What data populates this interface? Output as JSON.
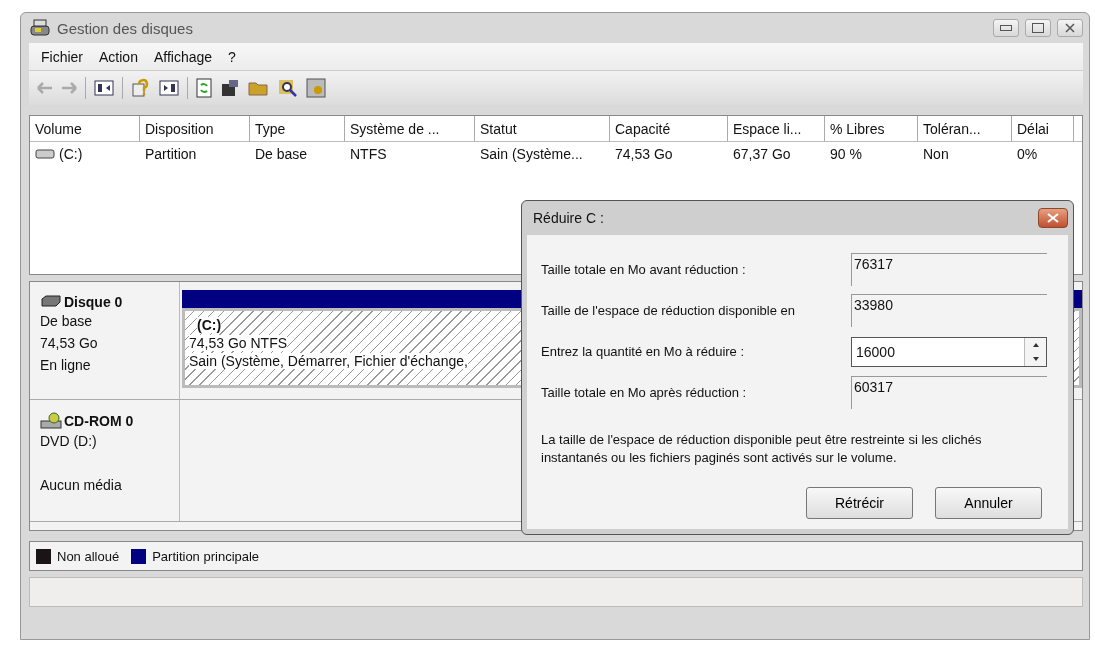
{
  "window": {
    "title": "Gestion des disques"
  },
  "menu": [
    "Fichier",
    "Action",
    "Affichage",
    "?"
  ],
  "volume_table": {
    "columns": [
      "Volume",
      "Disposition",
      "Type",
      "Système de ...",
      "Statut",
      "Capacité",
      "Espace li...",
      "% Libres",
      "Toléran...",
      "Délai"
    ],
    "rows": [
      {
        "cells": [
          "(C:)",
          "Partition",
          "De base",
          "NTFS",
          "Sain (Système...",
          "74,53 Go",
          "67,37 Go",
          "90 %",
          "Non",
          "0%"
        ]
      }
    ]
  },
  "disks": [
    {
      "kind": "disk",
      "name": "Disque 0",
      "info": [
        "De base",
        "74,53 Go",
        "En ligne"
      ],
      "partitions": [
        {
          "label": "(C:)",
          "size": "74,53 Go NTFS",
          "status": "Sain (Système, Démarrer, Fichier d'échange,"
        }
      ]
    },
    {
      "kind": "cdrom",
      "name": "CD-ROM 0",
      "info": [
        "DVD (D:)",
        "Aucun média"
      ]
    }
  ],
  "legend": [
    {
      "label": "Non alloué",
      "color": "#1a1416"
    },
    {
      "label": "Partition principale",
      "color": "#000080"
    }
  ],
  "dialog": {
    "title": "Réduire C :",
    "fields": [
      {
        "kind": "readonly",
        "label": "Taille totale en Mo avant réduction :",
        "value": "76317"
      },
      {
        "kind": "readonly",
        "label": "Taille de l'espace de réduction disponible en",
        "value": "33980"
      },
      {
        "kind": "spin",
        "label": "Entrez la quantité en Mo à réduire :",
        "value": "16000"
      },
      {
        "kind": "readonly",
        "label": "Taille totale en Mo après réduction :",
        "value": "60317"
      }
    ],
    "note": "La taille de l'espace de réduction disponible peut être restreinte si les clichés instantanés ou les fichiers paginés sont activés sur le volume.",
    "buttons": [
      "Rétrécir",
      "Annuler"
    ]
  }
}
